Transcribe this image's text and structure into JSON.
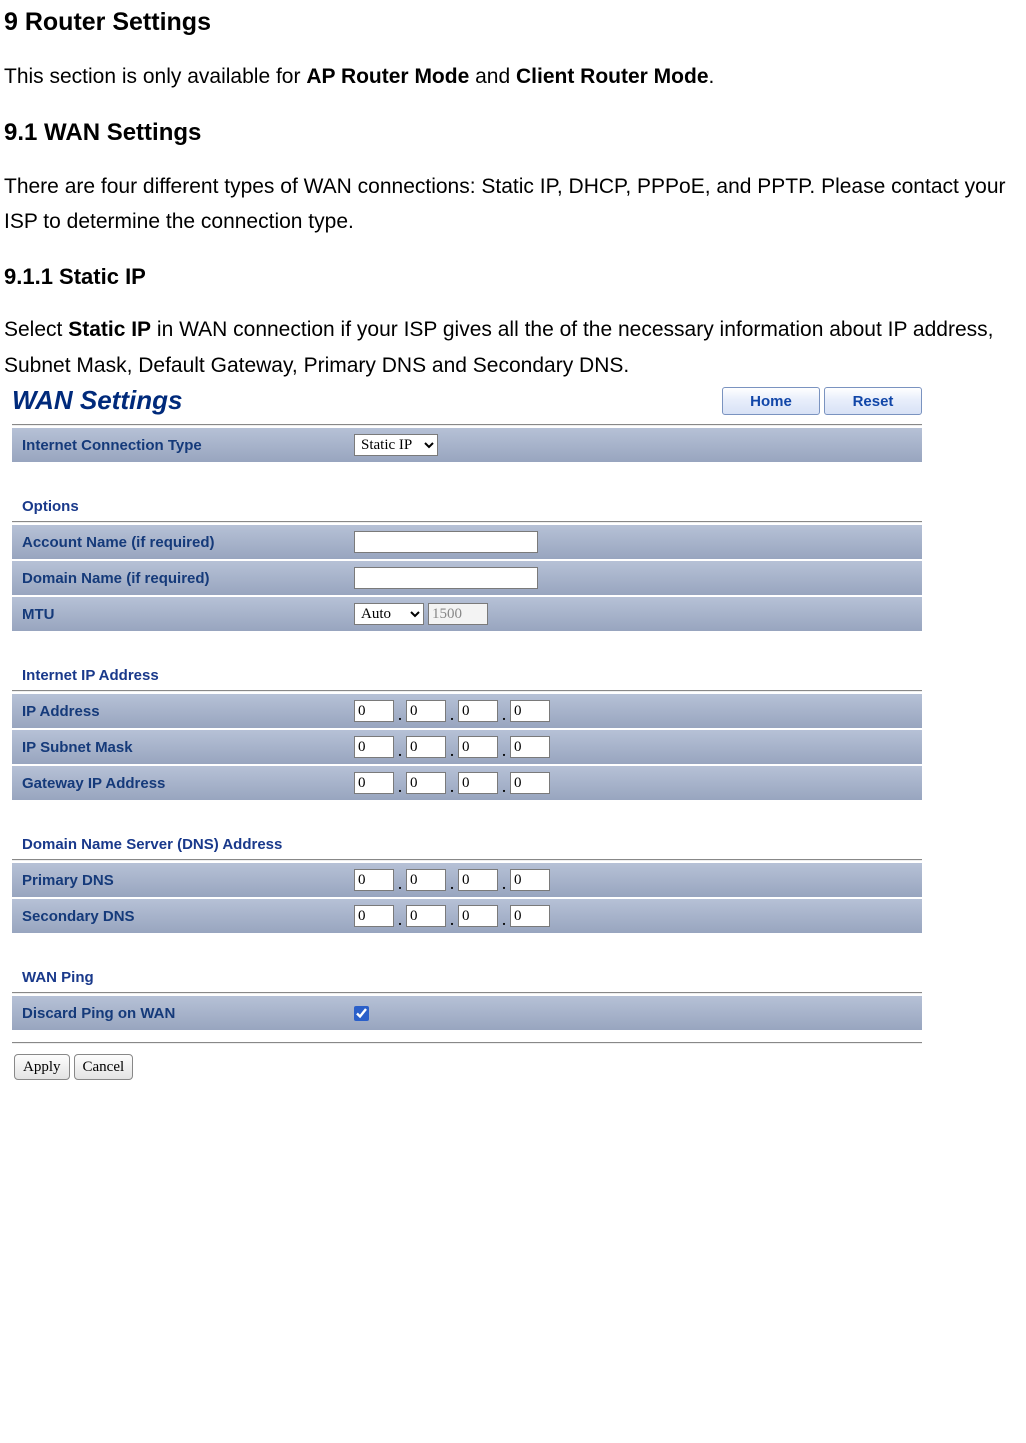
{
  "doc": {
    "h1": "9 Router Settings",
    "intro_pre": "This section is only available for ",
    "intro_b1": "AP Router Mode",
    "intro_mid": " and ",
    "intro_b2": "Client Router Mode",
    "intro_post": ".",
    "h2": "9.1 WAN Settings",
    "p1": "There are four different types of WAN connections: Static IP, DHCP, PPPoE, and PPTP. Please contact your ISP to determine the connection type.",
    "h3": "9.1.1 Static IP",
    "p2_pre": "Select ",
    "p2_b": "Static IP",
    "p2_post": " in WAN connection if your ISP gives all the of the necessary information about IP address, Subnet Mask, Default Gateway, Primary DNS and Secondary DNS."
  },
  "panel": {
    "title": "WAN Settings",
    "home_btn": "Home",
    "reset_btn": "Reset",
    "conn_type_label": "Internet Connection Type",
    "conn_type_value": "Static IP",
    "options_head": "Options",
    "account_label": "Account Name (if required)",
    "account_value": "",
    "domain_label": "Domain Name (if required)",
    "domain_value": "",
    "mtu_label": "MTU",
    "mtu_mode": "Auto",
    "mtu_value": "1500",
    "ip_head": "Internet IP Address",
    "ipaddr_label": "IP Address",
    "ipaddr": [
      "0",
      "0",
      "0",
      "0"
    ],
    "subnet_label": "IP Subnet Mask",
    "subnet": [
      "0",
      "0",
      "0",
      "0"
    ],
    "gw_label": "Gateway IP Address",
    "gw": [
      "0",
      "0",
      "0",
      "0"
    ],
    "dns_head": "Domain Name Server (DNS) Address",
    "pdns_label": "Primary DNS",
    "pdns": [
      "0",
      "0",
      "0",
      "0"
    ],
    "sdns_label": "Secondary DNS",
    "sdns": [
      "0",
      "0",
      "0",
      "0"
    ],
    "wanping_head": "WAN Ping",
    "discard_label": "Discard Ping on WAN",
    "discard_checked": true,
    "apply_btn": "Apply",
    "cancel_btn": "Cancel",
    "dot": "."
  }
}
